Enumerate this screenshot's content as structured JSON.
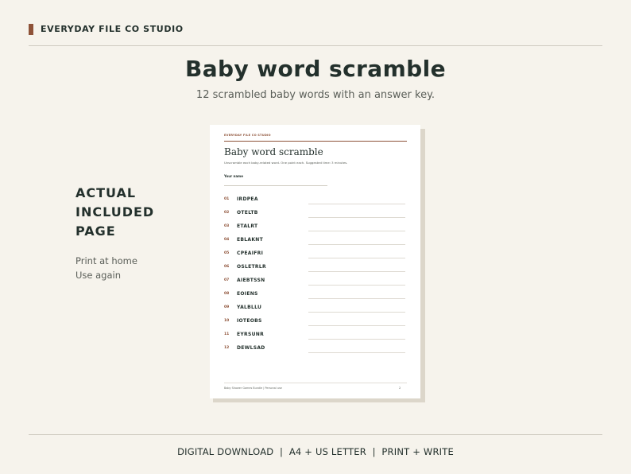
{
  "brand": "EVERYDAY FILE CO STUDIO",
  "hero": {
    "title": "Baby word scramble",
    "subtitle": "12 scrambled baby words with an answer key."
  },
  "side": {
    "heading": [
      "ACTUAL",
      "INCLUDED",
      "PAGE"
    ],
    "notes": [
      "Print at home",
      "Use again"
    ]
  },
  "sheet": {
    "brand": "EVERYDAY FILE CO STUDIO",
    "title": "Baby word scramble",
    "instructions": "Unscramble each baby-related word. One point each. Suggested time: 3 minutes.",
    "name_label": "Your name",
    "items": [
      {
        "num": "01",
        "word": "IRDPEA"
      },
      {
        "num": "02",
        "word": "OTELTB"
      },
      {
        "num": "03",
        "word": "ETALRT"
      },
      {
        "num": "04",
        "word": "EBLAKNT"
      },
      {
        "num": "05",
        "word": "CPEAIFRI"
      },
      {
        "num": "06",
        "word": "OSLETRLR"
      },
      {
        "num": "07",
        "word": "AIEBTSSN"
      },
      {
        "num": "08",
        "word": "EOIENS"
      },
      {
        "num": "09",
        "word": "YALBLLU"
      },
      {
        "num": "10",
        "word": "IOTEOBS"
      },
      {
        "num": "11",
        "word": "EYRSUNR"
      },
      {
        "num": "12",
        "word": "DEWLSAD"
      }
    ],
    "footer": "Baby Shower Games Bundle | Personal use",
    "page_number": "2"
  },
  "footer": "DIGITAL DOWNLOAD  |  A4 + US LETTER  |  PRINT + WRITE",
  "colors": {
    "background": "#f6f3ec",
    "accent": "#8e5238",
    "text": "#23302c"
  }
}
